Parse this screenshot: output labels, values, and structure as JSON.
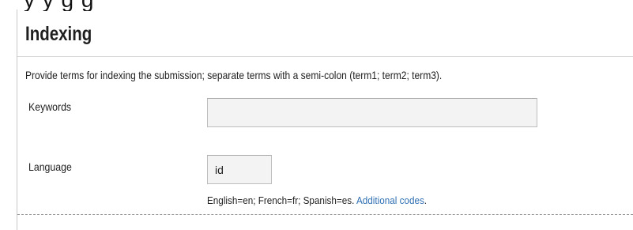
{
  "header_fragment": "y                    y g g",
  "section": {
    "title": "Indexing",
    "instructions": "Provide terms for indexing the submission; separate terms with a semi-colon (term1; term2; term3)."
  },
  "fields": {
    "keywords": {
      "label": "Keywords",
      "value": "",
      "placeholder": ""
    },
    "language": {
      "label": "Language",
      "value": "id",
      "hint_prefix": "English=en; French=fr; Spanish=es. ",
      "hint_link": "Additional codes",
      "hint_suffix": "."
    }
  },
  "colors": {
    "link": "#2f6fb3",
    "input_background": "#f3f3f3",
    "divider": "#8f8f8f"
  }
}
